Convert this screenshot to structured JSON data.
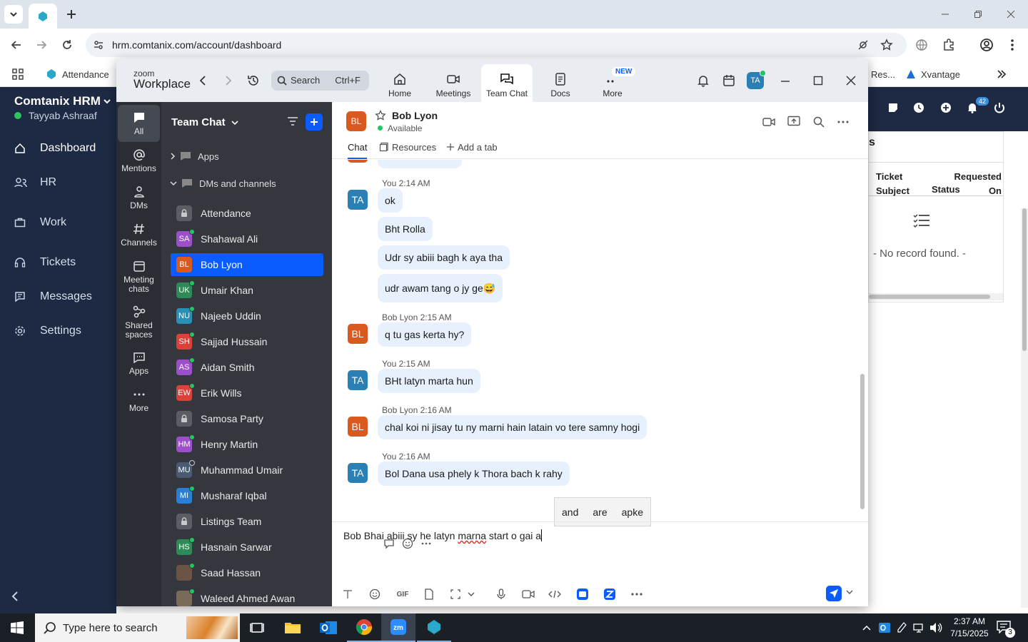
{
  "browser": {
    "url": "hrm.comtanix.com/account/dashboard",
    "bookmarks": [
      {
        "label": "Attendance"
      },
      {
        "label": "Res..."
      },
      {
        "label": "Xvantage"
      }
    ]
  },
  "hrm": {
    "brand": "Comtanix HRM",
    "user": "Tayyab Ashraaf",
    "nav": [
      {
        "label": "Dashboard",
        "icon": "home-icon"
      },
      {
        "label": "HR",
        "icon": "users-icon"
      },
      {
        "label": "Work",
        "icon": "briefcase-icon"
      },
      {
        "label": "Tickets",
        "icon": "headset-icon"
      },
      {
        "label": "Messages",
        "icon": "message-icon"
      },
      {
        "label": "Settings",
        "icon": "gear-icon"
      }
    ],
    "notification_count": "42",
    "card_title_fragment": "s",
    "table_headers": [
      "Ticket Subject",
      "Status",
      "Requested On"
    ],
    "empty_text": "- No record found. -"
  },
  "zoom": {
    "logo_top": "zoom",
    "logo_bottom": "Workplace",
    "search_placeholder": "Search",
    "search_shortcut": "Ctrl+F",
    "nav_tabs": [
      {
        "label": "Home"
      },
      {
        "label": "Meetings"
      },
      {
        "label": "Team Chat"
      },
      {
        "label": "Docs"
      },
      {
        "label": "More",
        "badge": "NEW"
      }
    ],
    "user_initials": "TA",
    "rail": [
      {
        "label": "All"
      },
      {
        "label": "Mentions"
      },
      {
        "label": "DMs"
      },
      {
        "label": "Channels"
      },
      {
        "label": "Meeting chats"
      },
      {
        "label": "Shared spaces"
      },
      {
        "label": "Apps"
      },
      {
        "label": "More"
      }
    ],
    "list_title": "Team Chat",
    "sections": [
      "Apps",
      "DMs and channels"
    ],
    "dms": [
      {
        "name": "Attendance",
        "type": "lock"
      },
      {
        "name": "Shahawal Ali",
        "initials": "SA",
        "color": "#9b4fc9",
        "status": "on"
      },
      {
        "name": "Bob Lyon",
        "initials": "BL",
        "color": "#d9591e",
        "status": "none",
        "selected": true
      },
      {
        "name": "Umair Khan",
        "initials": "UK",
        "color": "#2e8b57",
        "status": "on"
      },
      {
        "name": "Najeeb Uddin",
        "initials": "NU",
        "color": "#2a8fb5",
        "status": "on"
      },
      {
        "name": "Sajjad Hussain",
        "initials": "SH",
        "color": "#d9413a",
        "status": "on"
      },
      {
        "name": "Aidan Smith",
        "initials": "AS",
        "color": "#9b4fc9",
        "status": "on"
      },
      {
        "name": "Erik Wills",
        "initials": "EW",
        "color": "#d9413a",
        "status": "on"
      },
      {
        "name": "Samosa Party",
        "type": "lock"
      },
      {
        "name": "Henry Martin",
        "initials": "HM",
        "color": "#9b4fc9",
        "status": "on"
      },
      {
        "name": "Muhammad Umair",
        "initials": "MU",
        "color": "#4a5a72",
        "status": "off"
      },
      {
        "name": "Musharaf Iqbal",
        "initials": "MI",
        "color": "#2a7fd5",
        "status": "on"
      },
      {
        "name": "Listings Team",
        "type": "lock"
      },
      {
        "name": "Hasnain Sarwar",
        "initials": "HS",
        "color": "#2e8b57",
        "status": "on"
      },
      {
        "name": "Saad Hassan",
        "initials": "",
        "color": "#6b5444",
        "status": "on"
      },
      {
        "name": "Waleed Ahmed Awan",
        "initials": "",
        "color": "#7a6a5a",
        "status": "on"
      }
    ],
    "chat": {
      "contact": "Bob Lyon",
      "contact_initials": "BL",
      "presence": "Available",
      "tabs": [
        "Chat",
        "Resources",
        "Add a tab"
      ],
      "messages": [
        {
          "sender": "You",
          "initials": "TA",
          "time": "You 2:14 AM",
          "lines": [
            "ok",
            "Bht Rolla",
            "Udr sy abiii bagh k aya tha",
            "udr awam tang o jy ge😅"
          ]
        },
        {
          "sender": "Bob Lyon",
          "initials": "BL",
          "time": "Bob Lyon 2:15 AM",
          "lines": [
            "q tu gas kerta hy?"
          ]
        },
        {
          "sender": "You",
          "initials": "TA",
          "time": "You 2:15 AM",
          "lines": [
            "BHt latyn marta hun"
          ]
        },
        {
          "sender": "Bob Lyon",
          "initials": "BL",
          "time": "Bob Lyon 2:16 AM",
          "lines": [
            "chal koi ni jisay tu ny marni hain latain vo tere samny hogi"
          ]
        },
        {
          "sender": "You",
          "initials": "TA",
          "time": "You 2:16 AM",
          "lines": [
            "Bol Dana usa phely k Thora bach k rahy"
          ]
        }
      ],
      "suggestions": [
        "and",
        "are",
        "apke"
      ],
      "draft": "Bob Bhai abiii sy he latyn marna start o gai a",
      "draft_parts": {
        "before": "Bob Bhai abiii sy he latyn ",
        "misspelled": "marna",
        "after": " start o gai a"
      },
      "gif_label": "GIF"
    },
    "colors": {
      "accent": "#0b5cff",
      "avatar_you": "#2a7fb5",
      "avatar_bob": "#d9591e"
    }
  },
  "taskbar": {
    "search_placeholder": "Type here to search",
    "time": "2:37 AM",
    "date": "7/15/2025",
    "notif_count": "3"
  }
}
